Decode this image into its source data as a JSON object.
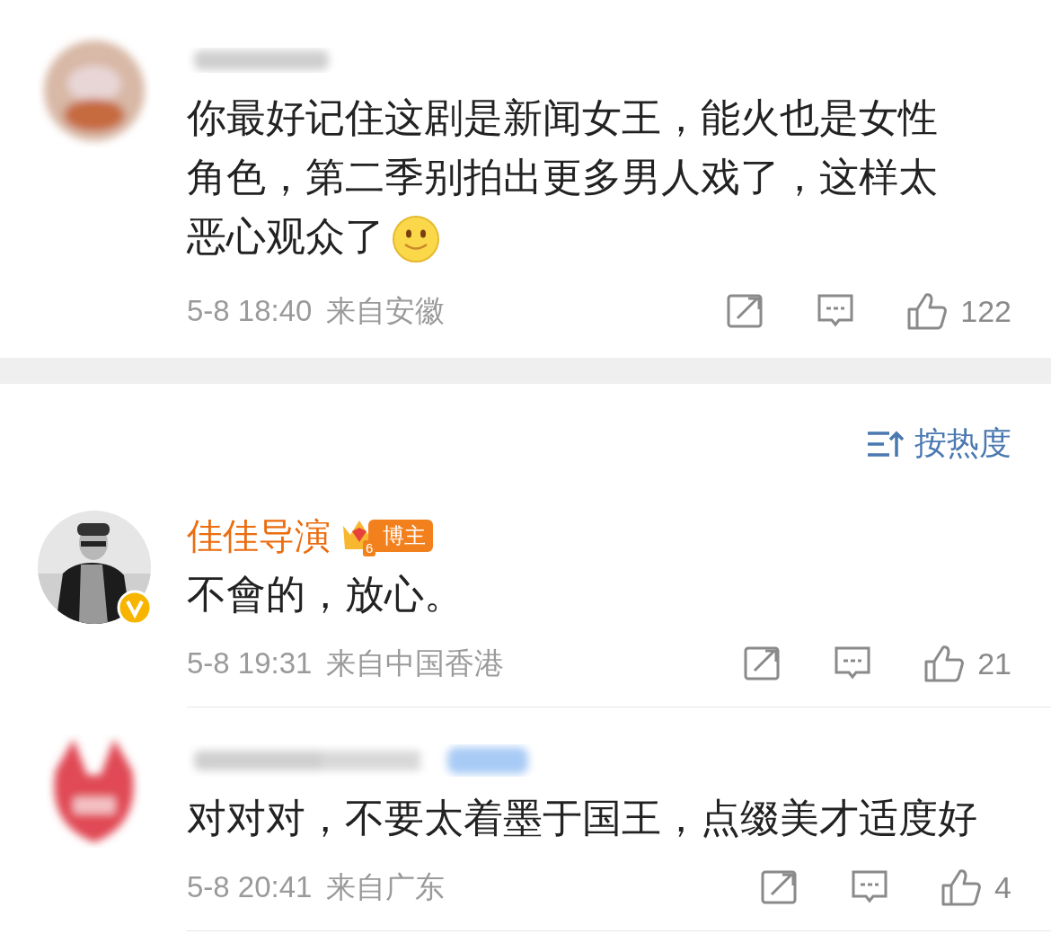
{
  "top_comment": {
    "name_hidden": true,
    "verified": false,
    "text": "你最好记住这剧是新闻女王，能火也是女性角色，第二季别拍出更多男人戏了，这样太恶心观众了",
    "emoji": true,
    "time": "5-8 18:40",
    "location": "来自安徽",
    "likes": "122"
  },
  "sort": {
    "label": "按热度"
  },
  "comments": [
    {
      "name_hidden": false,
      "name": "佳佳导演",
      "badge": {
        "level": "6",
        "label": "博主"
      },
      "verified": true,
      "text": "不會的，放心。",
      "emoji": false,
      "time": "5-8 19:31",
      "location": "来自中国香港",
      "likes": "21"
    },
    {
      "name_hidden": true,
      "verified": false,
      "text": "对对对，不要太着墨于国王，点缀美才适度好",
      "emoji": false,
      "time": "5-8 20:41",
      "location": "来自广东",
      "likes": "4"
    }
  ]
}
